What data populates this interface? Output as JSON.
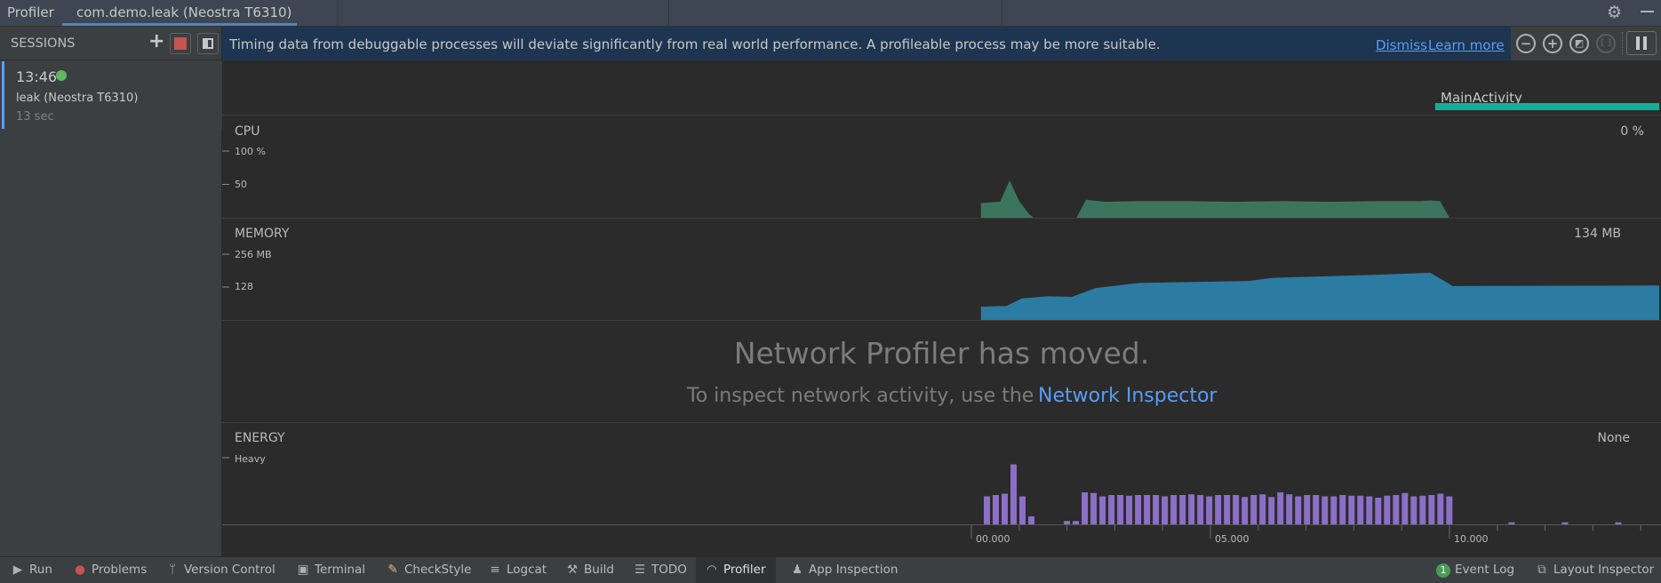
{
  "tabs": [
    {
      "label": "Profiler"
    },
    {
      "label": "com.demo.leak (Neostra T6310)",
      "active": true
    }
  ],
  "window_icons": [
    "gear-icon",
    "minimize-icon"
  ],
  "sessions": {
    "title": "SESSIONS",
    "items": [
      {
        "time": "13:46",
        "name": "leak (Neostra T6310)",
        "duration": "13 sec",
        "status": "live",
        "status_color": "#5fb760"
      }
    ]
  },
  "banner": {
    "message": "Timing data from debuggable processes will deviate significantly from real world performance. A profileable process may be more suitable.",
    "dismiss": "Dismiss",
    "learn_more": "Learn more"
  },
  "controls": [
    "zoom-out-icon",
    "zoom-in-icon",
    "reset-zoom-icon",
    "zoom-to-selection-icon",
    "pause-icon"
  ],
  "activity": {
    "label": "MainActivity",
    "start_s": 9.7,
    "color": "#12b09a"
  },
  "cpu": {
    "label": "CPU",
    "value": "0 %",
    "ticks": [
      "100 %",
      "50"
    ],
    "color": "#3b7560"
  },
  "memory": {
    "label": "MEMORY",
    "value": "134 MB",
    "ticks": [
      "256 MB",
      "128"
    ],
    "color": "#2b7ba3"
  },
  "network": {
    "title": "Network Profiler has moved.",
    "subtitle": "To inspect network activity, use the",
    "link": "Network Inspector"
  },
  "energy": {
    "label": "ENERGY",
    "value": "None",
    "ticks": [
      "Heavy"
    ],
    "color": "#8c6fc7"
  },
  "time_axis": {
    "labels": [
      "00.000",
      "05.000",
      "10.000"
    ]
  },
  "chart_data": [
    {
      "type": "area",
      "title": "CPU",
      "ylabel": "%",
      "ylim": [
        0,
        100
      ],
      "x": [
        0.2,
        0.6,
        0.8,
        1.0,
        1.2,
        1.3,
        2.2,
        2.4,
        2.8,
        3.5,
        4.5,
        5.5,
        6.5,
        7.5,
        8.5,
        9.4,
        9.6,
        9.8,
        10.0
      ],
      "y": [
        22,
        24,
        56,
        25,
        6,
        0,
        0,
        27,
        24,
        25,
        25,
        24,
        25,
        24,
        25,
        25,
        26,
        25,
        0
      ]
    },
    {
      "type": "area",
      "title": "MEMORY",
      "ylabel": "MB",
      "ylim": [
        0,
        256
      ],
      "x": [
        0.2,
        0.73,
        1.06,
        1.6,
        2.1,
        2.6,
        3.5,
        5.8,
        6.3,
        8.5,
        9.6,
        10.07,
        14.4
      ],
      "y": [
        52,
        54,
        84,
        92,
        90,
        124,
        144,
        152,
        164,
        176,
        184,
        132,
        134
      ]
    },
    {
      "type": "bar",
      "title": "ENERGY",
      "ylim": [
        0,
        1
      ],
      "sample_interval_s": 0.186,
      "start_s": 0.26,
      "values": [
        0.42,
        0.44,
        0.46,
        0.9,
        0.42,
        0.12,
        0,
        0,
        0,
        0.05,
        0.05,
        0.48,
        0.47,
        0.42,
        0.44,
        0.44,
        0.43,
        0.44,
        0.44,
        0.44,
        0.42,
        0.44,
        0.44,
        0.45,
        0.44,
        0.42,
        0.44,
        0.44,
        0.44,
        0.41,
        0.44,
        0.45,
        0.41,
        0.48,
        0.45,
        0.42,
        0.44,
        0.44,
        0.42,
        0.42,
        0.44,
        0.43,
        0.43,
        0.42,
        0.4,
        0.43,
        0.44,
        0.47,
        0.42,
        0.43,
        0.44,
        0.46,
        0.42,
        0,
        0,
        0,
        0,
        0,
        0,
        0.03,
        0,
        0,
        0,
        0,
        0,
        0.03,
        0,
        0,
        0,
        0,
        0,
        0.03
      ]
    }
  ]
}
